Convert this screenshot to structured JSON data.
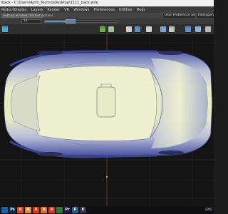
{
  "window": {
    "title": "tback - C:\\Users\\Azim_Techno\\Desktop\\1111_back.wire"
  },
  "menu": {
    "items": [
      "ReductDisplay",
      "Layers",
      "Render",
      "VR",
      "Windows",
      "Preferences",
      "Utilities",
      "Help"
    ]
  },
  "toolbar": {
    "dropdown_value": "Setting window: Barbar options",
    "preference_sets_label": "User Preference Sets",
    "interop_label": "Interoperab",
    "field_value": "14",
    "slider_level": 0.3
  },
  "shelf_icons": [
    {
      "name": "palette-icon",
      "color": "#4aa5c6"
    },
    {
      "name": "curve-icon",
      "color": "#6aa84f"
    },
    {
      "name": "surface-icon",
      "color": "#9bc49a"
    },
    {
      "name": "dim-icon",
      "color": "#d0d0d0"
    },
    {
      "name": "mesh-icon",
      "color": "#5a8fb8"
    },
    {
      "name": "grid-icon",
      "color": "#d0d0d0"
    },
    {
      "name": "camera-icon",
      "color": "#7fa7d6"
    },
    {
      "name": "eye-icon",
      "color": "#c5c5c5"
    },
    {
      "name": "settings-icon",
      "color": "#5f8fc0"
    },
    {
      "name": "light-icon",
      "color": "#8ab0d8"
    },
    {
      "name": "render-icon",
      "color": "#b8b8b8"
    }
  ],
  "taskbar": {
    "apps": [
      {
        "name": "windows-start-icon",
        "label": "",
        "color": "#1f5fa8"
      },
      {
        "name": "photoshop-icon",
        "label": "Ps",
        "color": "#0f2c56"
      },
      {
        "name": "app-a-icon",
        "label": "A",
        "color": "#cc4a2a"
      },
      {
        "name": "app-a2-icon",
        "label": "A",
        "color": "#e08a2a"
      },
      {
        "name": "app-a3-icon",
        "label": "A",
        "color": "#c8401e"
      },
      {
        "name": "app-a4-icon",
        "label": "A",
        "color": "#e07020"
      },
      {
        "name": "app-a5-icon",
        "label": "A",
        "color": "#c04020"
      },
      {
        "name": "app-green-icon",
        "label": "",
        "color": "#2a7a3a"
      },
      {
        "name": "app-pr-icon",
        "label": "Pr",
        "color": "#1b1b4a"
      },
      {
        "name": "app-p-icon",
        "label": "P",
        "color": "#1b5e9a"
      },
      {
        "name": "app-k-icon",
        "label": "K",
        "color": "#334"
      }
    ],
    "tray_text": "ENG"
  }
}
